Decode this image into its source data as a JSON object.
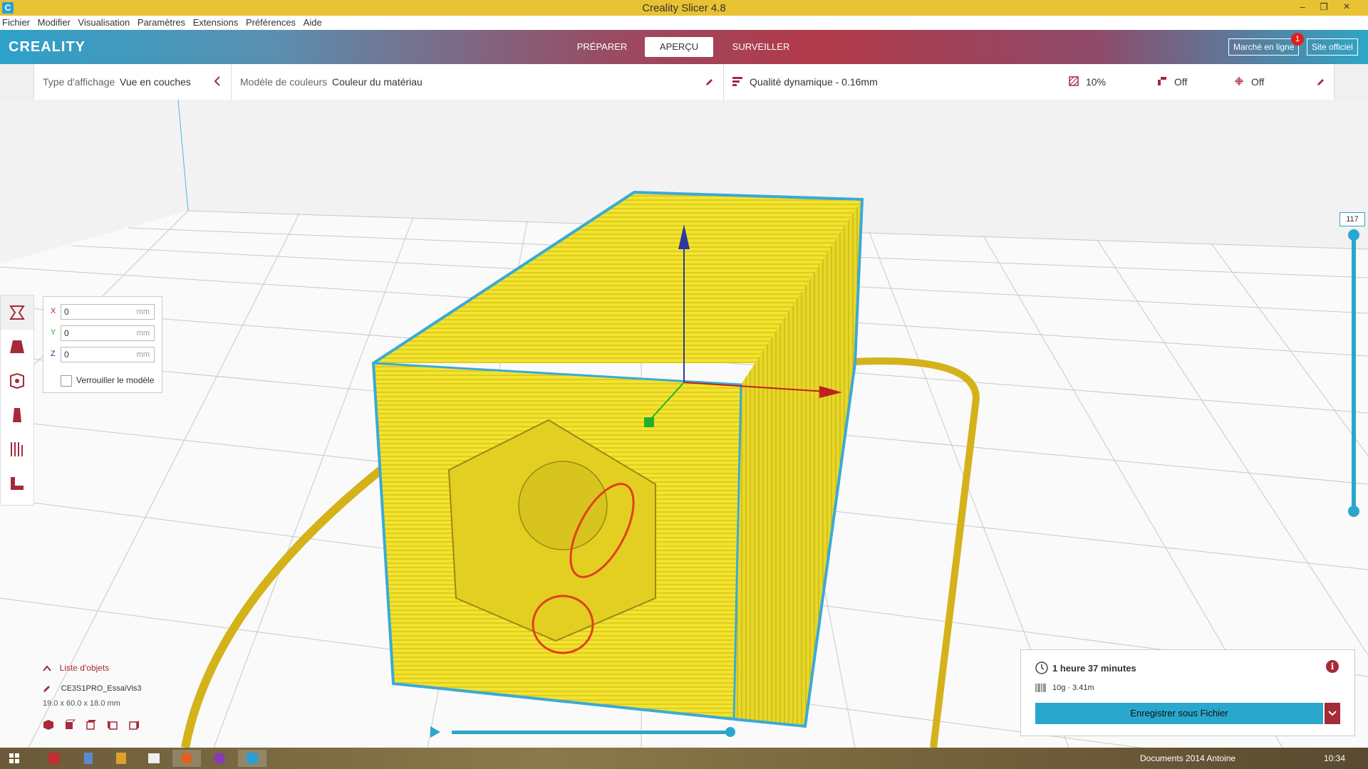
{
  "window": {
    "title": "Creality Slicer 4.8",
    "minimize": "–",
    "maximize": "❐",
    "close": "×"
  },
  "menu": [
    "Fichier",
    "Modifier",
    "Visualisation",
    "Paramètres",
    "Extensions",
    "Préférences",
    "Aide"
  ],
  "header": {
    "logo": "CREALITY",
    "tabs": [
      "PRÉPARER",
      "APERÇU",
      "SURVEILLER"
    ],
    "active_tab": "APERÇU",
    "market_button": "Marché en ligne",
    "market_badge": "1",
    "site_button": "Site officiel"
  },
  "toolbar": {
    "display_type_label": "Type d'affichage",
    "display_type_value": "Vue en couches",
    "color_model_label": "Modèle de couleurs",
    "color_model_value": "Couleur du matériau",
    "quality": "Qualité dynamique - 0.16mm",
    "infill": "10%",
    "support": "Off",
    "adhesion": "Off"
  },
  "move_panel": {
    "x_label": "X",
    "x_value": "0",
    "y_label": "Y",
    "y_value": "0",
    "z_label": "Z",
    "z_value": "0",
    "unit": "mm",
    "lock_label": "Verrouiller le modèle"
  },
  "object_list": {
    "title": "Liste d'objets",
    "object_name": "CE3S1PRO_EssaiVis3",
    "dimensions": "19.0 x 60.0 x 18.0 mm"
  },
  "layer_slider": {
    "current_layer": "117"
  },
  "print_info": {
    "time": "1 heure 37 minutes",
    "material": "10g · 3.41m",
    "save_button": "Enregistrer sous Fichier"
  },
  "taskbar": {
    "folder_label": "Documents 2014 Antoine",
    "clock": "10:34"
  },
  "colors": {
    "accent": "#2aa7cc",
    "brand_red": "#a52a3a",
    "model_yellow": "#f2e22a",
    "title_bar": "#e8c233"
  }
}
